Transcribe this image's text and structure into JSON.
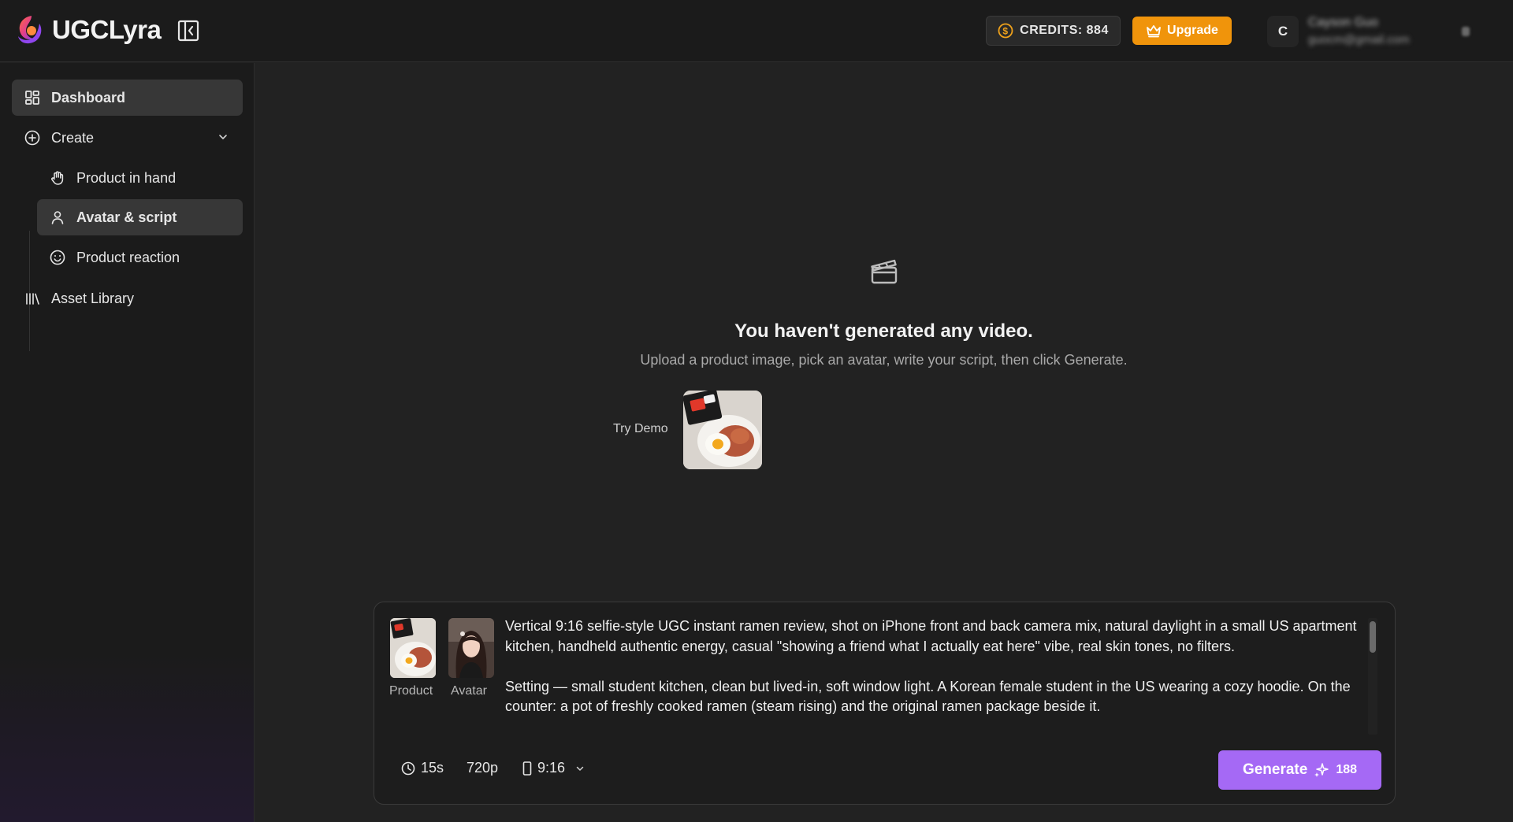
{
  "header": {
    "brand": "UGCLyra",
    "credits_label": "CREDITS: 884",
    "upgrade_label": "Upgrade",
    "user_initial": "C",
    "user_name": "Cayson Guo",
    "user_email": "guocm@gmail.com"
  },
  "sidebar": {
    "dashboard": "Dashboard",
    "create": "Create",
    "sub_items": [
      {
        "label": "Product in hand",
        "icon": "hand-icon"
      },
      {
        "label": "Avatar & script",
        "icon": "user-icon"
      },
      {
        "label": "Product reaction",
        "icon": "smile-icon"
      }
    ],
    "asset_library": "Asset Library"
  },
  "empty_state": {
    "title": "You haven't generated any video.",
    "subtitle": "Upload a product image, pick an avatar, write your script, then click Generate.",
    "try_demo": "Try Demo"
  },
  "composer": {
    "product_label": "Product",
    "avatar_label": "Avatar",
    "prompt_p1": "Vertical 9:16 selfie-style UGC instant ramen review, shot on iPhone front and back camera mix, natural daylight in a small US apartment kitchen, handheld authentic energy, casual \"showing a friend what I actually eat here\" vibe, real skin tones, no filters.",
    "prompt_p2": "Setting — small student kitchen, clean but lived-in, soft window light. A Korean female student in the US wearing a cozy hoodie. On the counter: a pot of freshly cooked ramen (steam rising) and the original ramen package beside it.",
    "duration": "15s",
    "resolution": "720p",
    "aspect": "9:16",
    "generate_label": "Generate",
    "generate_cost": "188"
  },
  "colors": {
    "accent_orange": "#f0940b",
    "accent_purple": "#a569f5",
    "background": "#222222",
    "sidebar": "#1b1b1b"
  }
}
